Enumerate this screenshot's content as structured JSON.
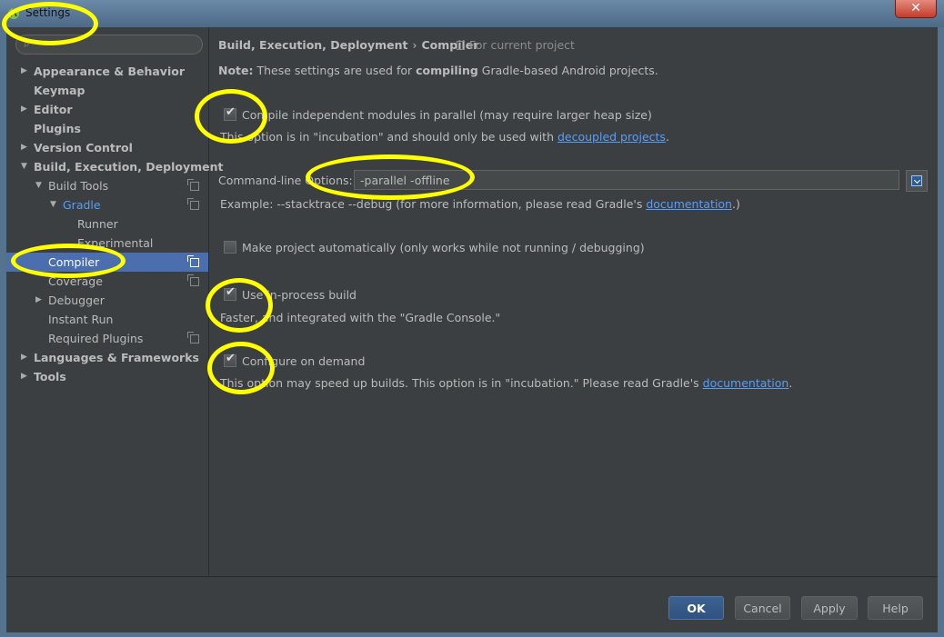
{
  "window": {
    "title": "Settings",
    "close_glyph": "✕"
  },
  "search": {
    "placeholder": "",
    "icon": "search-icon"
  },
  "sidebar": {
    "items": [
      {
        "label": "Appearance & Behavior",
        "arrow": "▶"
      },
      {
        "label": "Keymap"
      },
      {
        "label": "Editor",
        "arrow": "▶"
      },
      {
        "label": "Plugins"
      },
      {
        "label": "Version Control",
        "arrow": "▶"
      },
      {
        "label": "Build, Execution, Deployment",
        "arrow": "▼"
      },
      {
        "label": "Build Tools",
        "arrow": "▼"
      },
      {
        "label": "Gradle",
        "arrow": "▼"
      },
      {
        "label": "Runner"
      },
      {
        "label": "Experimental"
      },
      {
        "label": "Compiler"
      },
      {
        "label": "Coverage"
      },
      {
        "label": "Debugger",
        "arrow": "▶"
      },
      {
        "label": "Instant Run"
      },
      {
        "label": "Required Plugins"
      },
      {
        "label": "Languages & Frameworks",
        "arrow": "▶"
      },
      {
        "label": "Tools",
        "arrow": "▶"
      }
    ]
  },
  "header": {
    "crumb_parent": "Build, Execution, Deployment",
    "crumb_sep": "›",
    "crumb_current": "Compiler",
    "scope": "For current project"
  },
  "note": {
    "prefix": "Note:",
    "text_before": " These settings are used for ",
    "bold_word": "compiling",
    "text_after": " Gradle-based Android projects."
  },
  "options": {
    "parallel": {
      "label": "Compile independent modules in parallel (may require larger heap size)",
      "checked": true,
      "hint_before": "This option is in \"incubation\" and should only be used with ",
      "hint_link": "decoupled projects",
      "hint_after": "."
    },
    "cmdline": {
      "label": "Command-line Options:",
      "value": "-parallel -offline",
      "example_before": "Example: --stacktrace --debug (for more information, please read Gradle's ",
      "example_link": "documentation",
      "example_after": ".)"
    },
    "make_auto": {
      "label": "Make project automatically (only works while not running / debugging)",
      "checked": false
    },
    "in_process": {
      "label": "Use in-process build",
      "checked": true,
      "hint": "Faster, and integrated with the \"Gradle Console.\""
    },
    "on_demand": {
      "label": "Configure on demand",
      "checked": true,
      "hint_before": "This option may speed up builds. This option is in \"incubation.\" Please read Gradle's ",
      "hint_link": "documentation",
      "hint_after": "."
    }
  },
  "buttons": {
    "ok": "OK",
    "cancel": "Cancel",
    "apply": "Apply",
    "help": "Help"
  },
  "colors": {
    "selection": "#4b6eaf",
    "link": "#589df6",
    "highlight_marker": "#ffff00",
    "background": "#3c3f41"
  }
}
